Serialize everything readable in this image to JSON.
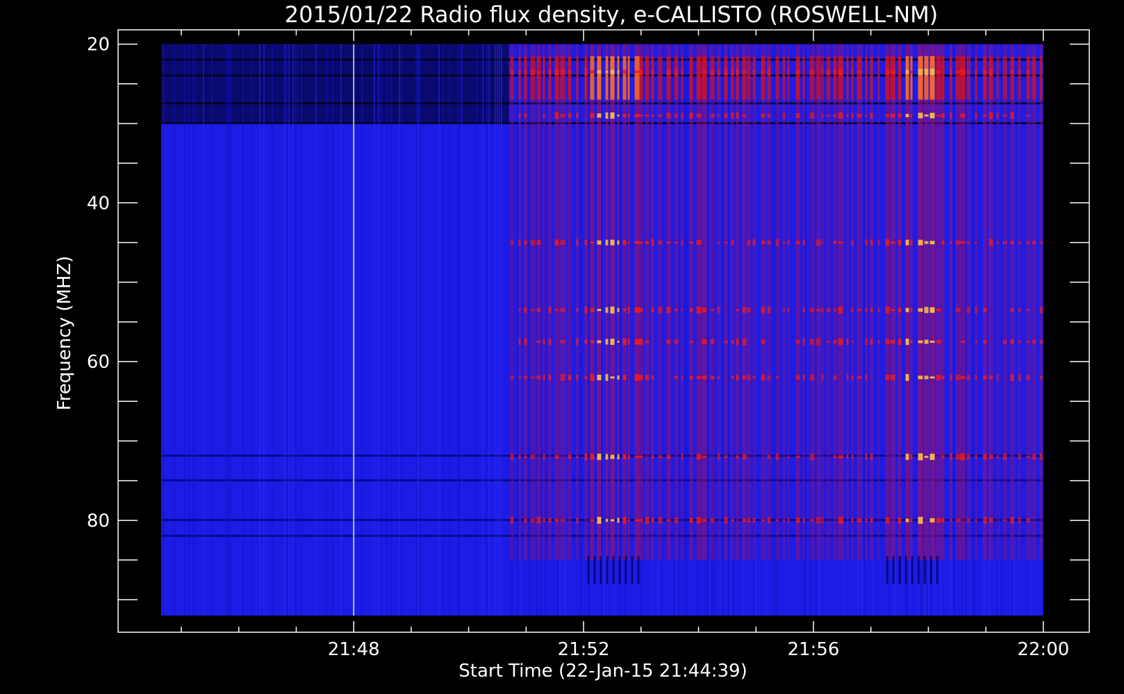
{
  "chart_data": {
    "type": "heatmap",
    "title": "2015/01/22  Radio flux density, e-CALLISTO (ROSWELL-NM)",
    "xlabel": "Start Time (22-Jan-15 21:44:39)",
    "ylabel": "Frequency (MHZ)",
    "x_ticks": [
      "21:48",
      "21:52",
      "21:56",
      "22:00"
    ],
    "y_ticks": [
      "20",
      "40",
      "60",
      "80"
    ],
    "x_range_minutes": [
      44.65,
      60.0
    ],
    "y_range_mhz": [
      20,
      92
    ],
    "axis_x_minutes": [
      43.9,
      60.8
    ],
    "axis_y_mhz": [
      18.2,
      94.1
    ],
    "data_start_minutes": 44.65,
    "data_end_minutes": 60.0,
    "burst_onset_minutes": 50.7,
    "impulse_line_minutes": 48.0,
    "interference_bands_mhz": [
      22,
      24,
      27.5,
      30,
      71.9,
      75,
      80,
      82
    ],
    "burst_bright_bands_mhz": [
      23.5,
      29,
      45,
      53.5,
      57.5,
      62,
      72,
      80
    ],
    "burst_peaks_minutes": [
      52.55,
      57.75
    ],
    "colormap": [
      "#000000",
      "#0000ff",
      "#ff0000",
      "#ffff00",
      "#ffffff"
    ],
    "background_color": "#000000",
    "plot_fill_color": "#1c1ce6"
  }
}
